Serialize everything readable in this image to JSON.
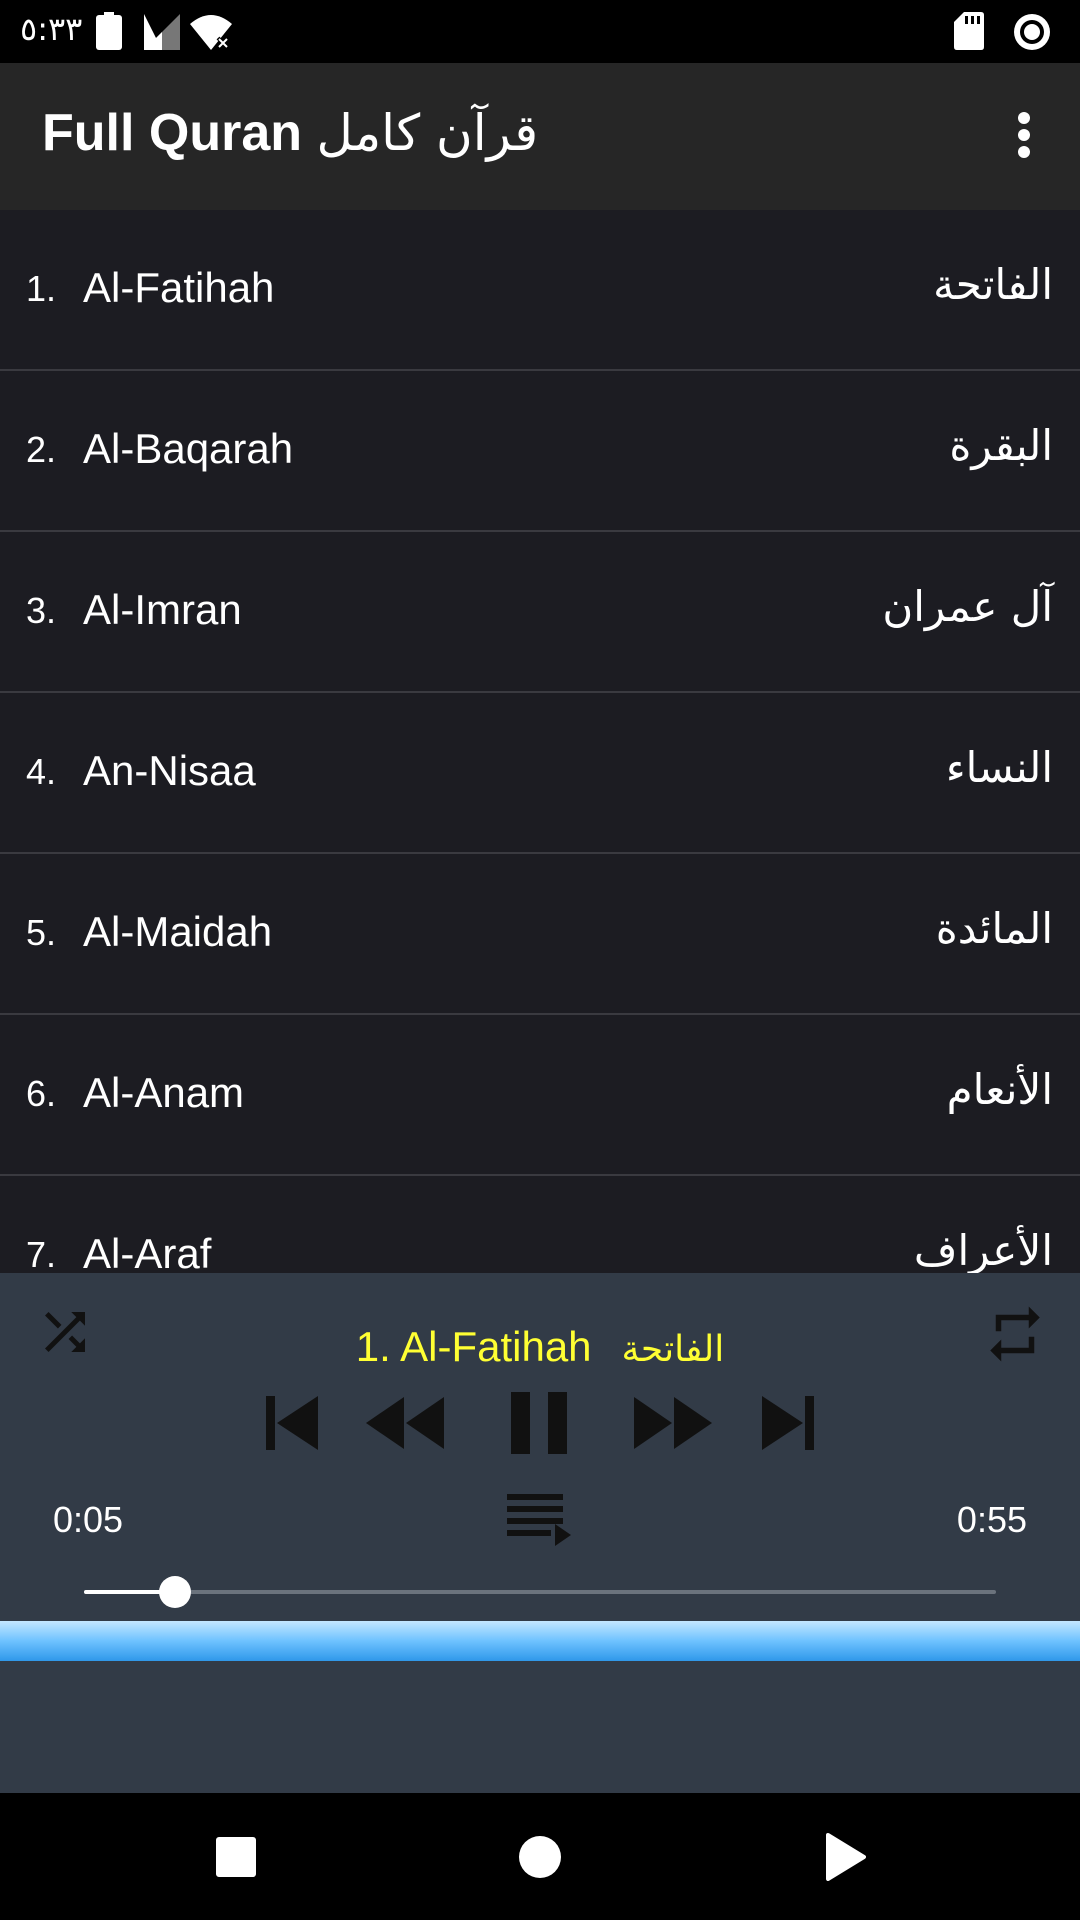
{
  "status_bar": {
    "time": "٥:٣٣"
  },
  "app_bar": {
    "title_en": "Full Quran",
    "title_ar": "قرآن كامل"
  },
  "surahs": [
    {
      "num": "1.",
      "en": "Al-Fatihah",
      "ar": "الفاتحة"
    },
    {
      "num": "2.",
      "en": "Al-Baqarah",
      "ar": "البقرة"
    },
    {
      "num": "3.",
      "en": "Al-Imran",
      "ar": "آل عمران"
    },
    {
      "num": "4.",
      "en": "An-Nisaa",
      "ar": "النساء"
    },
    {
      "num": "5.",
      "en": "Al-Maidah",
      "ar": "المائدة"
    },
    {
      "num": "6.",
      "en": "Al-Anam",
      "ar": "الأنعام"
    },
    {
      "num": "7.",
      "en": "Al-Araf",
      "ar": "الأعراف"
    }
  ],
  "player": {
    "now_playing_en": "1. Al-Fatihah",
    "now_playing_ar": "الفاتحة",
    "elapsed": "0:05",
    "duration": "0:55",
    "progress": 0.1
  },
  "colors": {
    "now_playing": "#ffff33",
    "list_bg": "#1c1c22",
    "player_bg": "#323b47",
    "app_bar_bg": "#262626"
  },
  "icons": {
    "status": [
      "sd-card-icon",
      "record-icon",
      "battery-icon",
      "cell-signal-icon",
      "wifi-icon"
    ],
    "player": [
      "shuffle-icon",
      "repeat-icon",
      "skip-previous-icon",
      "rewind-icon",
      "pause-icon",
      "fast-forward-icon",
      "skip-next-icon",
      "playlist-icon"
    ],
    "nav": [
      "nav-recents-icon",
      "nav-home-icon",
      "nav-back-icon"
    ]
  }
}
